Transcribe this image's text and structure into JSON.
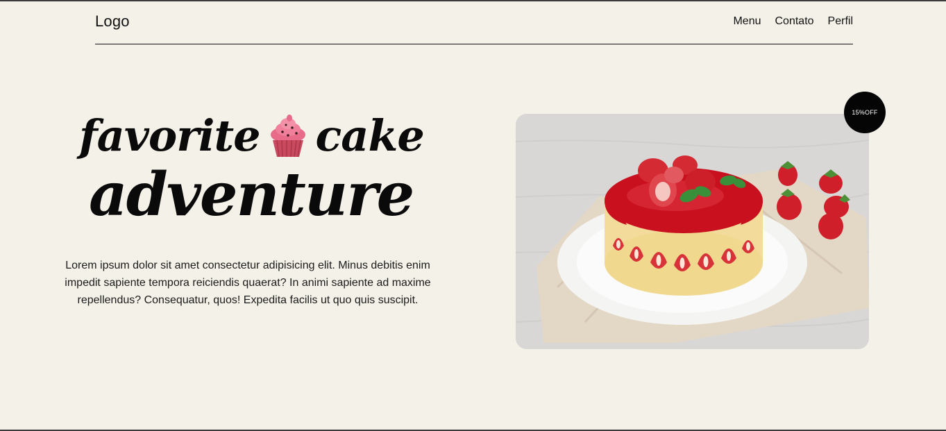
{
  "header": {
    "logo": "Logo",
    "nav": [
      {
        "label": "Menu"
      },
      {
        "label": "Contato"
      },
      {
        "label": "Perfil"
      }
    ]
  },
  "hero": {
    "title_word1": "favorite",
    "title_word2": "cake",
    "title_line2": "adventure",
    "title_icon": "cupcake-icon",
    "description": "Lorem ipsum dolor sit amet consectetur adipisicing elit. Minus debitis enim impedit sapiente tempora reiciendis quaerat? In animi sapiente ad maxime repellendus? Consequatur, quos! Expedita facilis ut quo quis suscipit.",
    "image_icon": "strawberry-cake-image",
    "badge": "15%OFF"
  },
  "colors": {
    "background": "#f4f1e8",
    "text": "#111111",
    "badge_bg": "#050505",
    "badge_text": "#ffffff",
    "glaze": "#d1222e"
  }
}
